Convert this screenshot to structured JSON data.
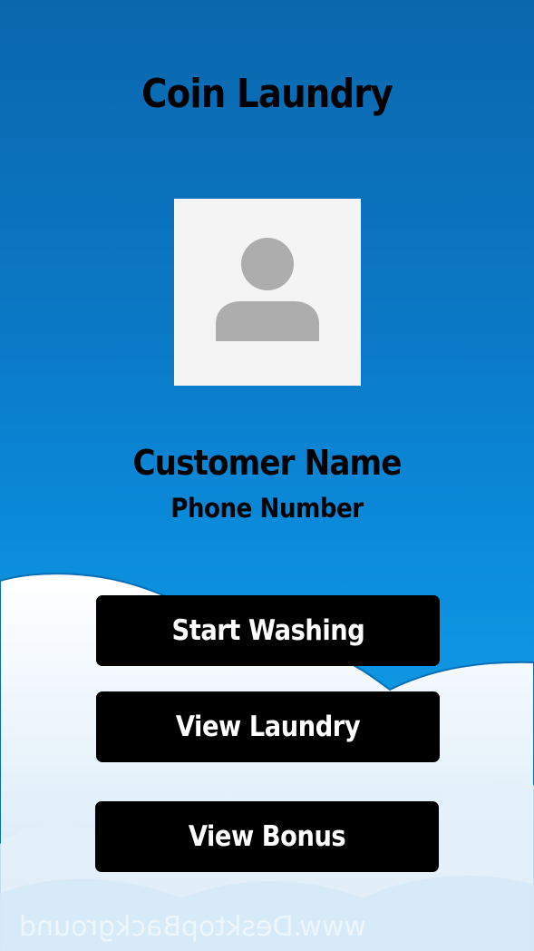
{
  "app": {
    "title": "Coin Laundry"
  },
  "profile": {
    "avatar_icon": "user-placeholder-icon",
    "customer_name": "Customer Name",
    "phone_number": "Phone Number"
  },
  "actions": {
    "start_washing": "Start Washing",
    "view_laundry": "View Laundry",
    "view_bonus": "View Bonus"
  },
  "background": {
    "watermark": "www.DesktopBackground",
    "sky_color": "#0b79c6",
    "cloud_color": "#ffffff"
  },
  "colors": {
    "button_bg": "#000000",
    "button_text": "#ffffff",
    "avatar_bg": "#f4f4f4",
    "avatar_icon": "#adadad"
  }
}
